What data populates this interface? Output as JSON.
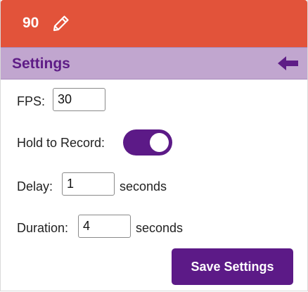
{
  "header": {
    "value": "90",
    "edit_icon": "pencil-icon",
    "color": "#e2533a"
  },
  "settings_bar": {
    "title": "Settings",
    "back_icon": "arrow-left-icon",
    "color": "#c1a6cf",
    "text_color": "#5e1c86"
  },
  "form": {
    "fps_label": "FPS:",
    "fps_value": "30",
    "hold_label": "Hold to Record:",
    "hold_enabled": true,
    "delay_label": "Delay:",
    "delay_value": "1",
    "delay_unit": "seconds",
    "duration_label": "Duration:",
    "duration_value": "4",
    "duration_unit": "seconds"
  },
  "actions": {
    "save_label": "Save Settings",
    "accent": "#5c1a87"
  }
}
